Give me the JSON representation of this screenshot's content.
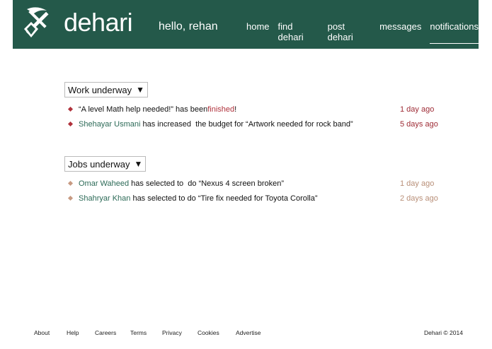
{
  "header": {
    "brand": "dehari",
    "greeting": "hello, rehan",
    "nav": [
      {
        "label": "home",
        "active": false
      },
      {
        "label": "find dehari",
        "active": false
      },
      {
        "label": "post dehari",
        "active": false
      },
      {
        "label": "messages",
        "active": false
      },
      {
        "label": "notifications",
        "active": true
      }
    ]
  },
  "work_section": {
    "title": "Work underway",
    "items": [
      {
        "pre": "“A level Math help needed!” has been ",
        "highlight": "finished",
        "post": "!",
        "time": "1 day ago"
      },
      {
        "name": "Shehayar Usmani",
        "text": " has increased  the budget for “Artwork needed for rock band”",
        "time": "5 days ago"
      }
    ]
  },
  "jobs_section": {
    "title": "Jobs underway",
    "items": [
      {
        "name": "Omar Waheed",
        "text": " has selected to  do “Nexus 4 screen broken”",
        "time": "1 day ago"
      },
      {
        "name": "Shahryar Khan",
        "text": " has selected to do “Tire fix needed for Toyota Corolla”",
        "time": "2 days ago"
      }
    ]
  },
  "footer": {
    "links": [
      "About",
      "Help",
      "Careers",
      "Terms",
      "Privacy",
      "Cookies",
      "Advertise"
    ],
    "copyright": "Dehari © 2014"
  },
  "colors": {
    "header_bg": "#24594a",
    "accent_red": "#b0323c",
    "name_green": "#2c6a57",
    "muted_tan": "#c79a82"
  }
}
